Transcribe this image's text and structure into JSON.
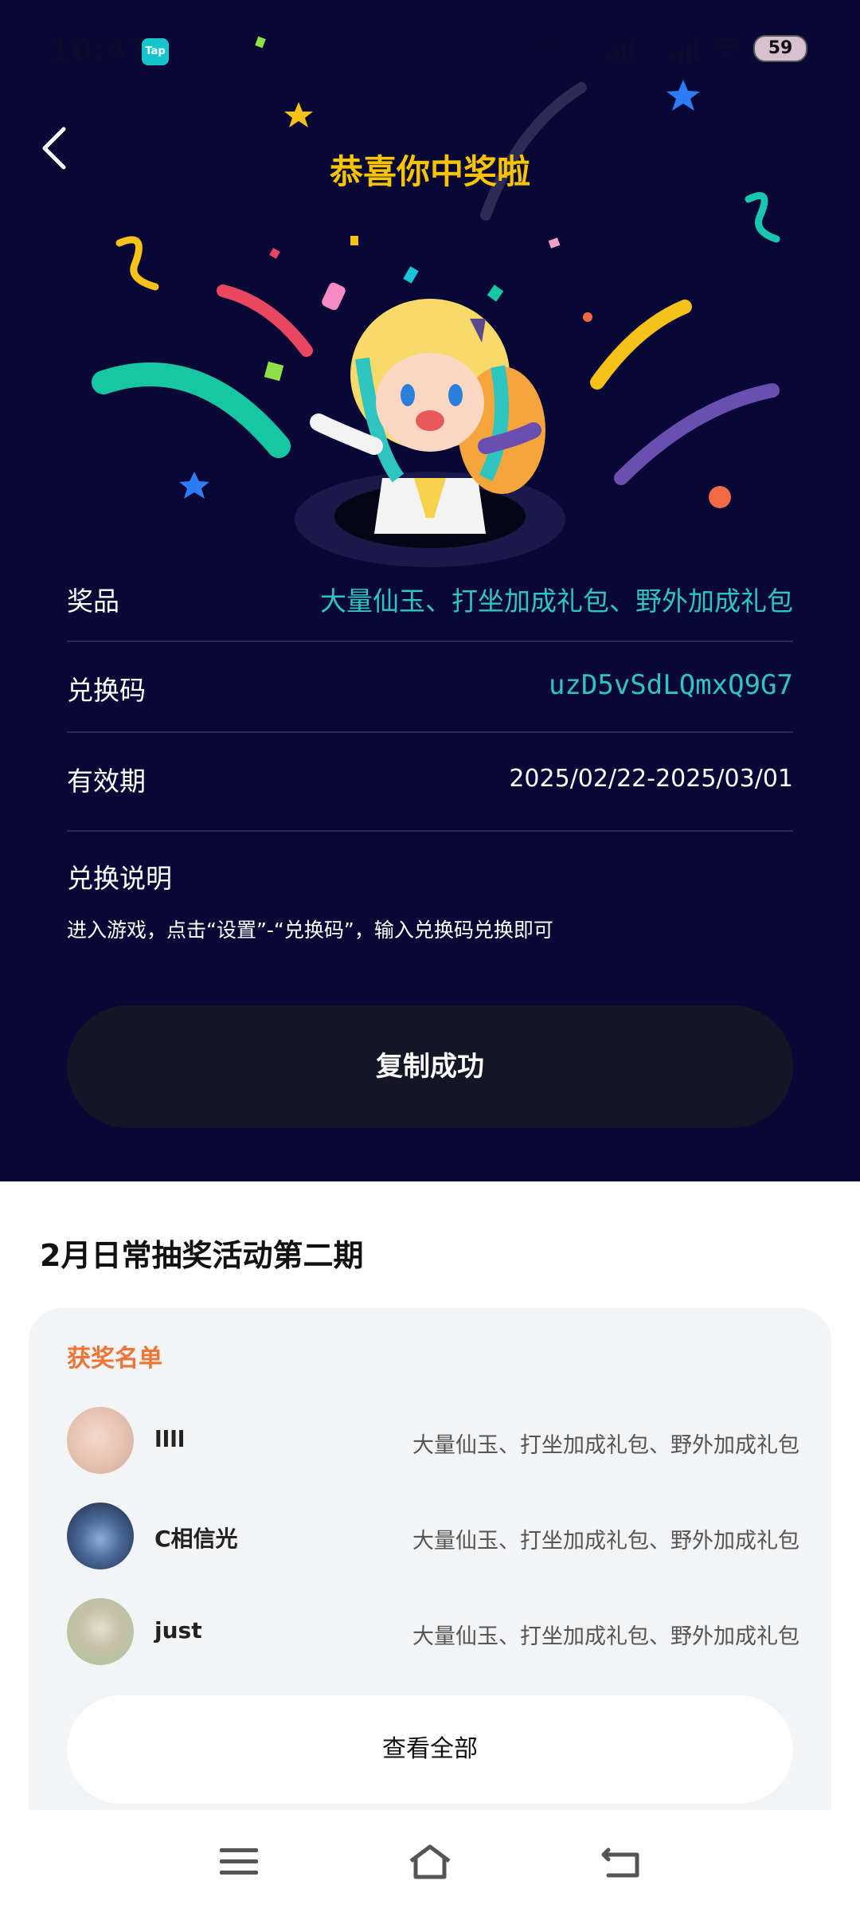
{
  "status_bar": {
    "time": "10:47",
    "app_badge": "Tap",
    "net_speed": "2.37 KB/s",
    "network_1": "5G",
    "network_2": "4G",
    "battery": "59"
  },
  "header": {
    "title": "恭喜你中奖啦"
  },
  "prize": {
    "prize_label": "奖品",
    "prize_value": "大量仙玉、打坐加成礼包、野外加成礼包",
    "code_label": "兑换码",
    "code_value": "uzD5vSdLQmxQ9G7",
    "validity_label": "有效期",
    "validity_value": "2025/02/22-2025/03/01",
    "instructions_label": "兑换说明",
    "instructions_text": "进入游戏，点击“设置”-“兑换码”，输入兑换码兑换即可",
    "copy_button": "复制成功"
  },
  "activity": {
    "title": "2月日常抽奖活动第二期",
    "winners_title": "获奖名单",
    "winners": [
      {
        "name": "llll",
        "prize": "大量仙玉、打坐加成礼包、野外加成礼包"
      },
      {
        "name": "C相信光",
        "prize": "大量仙玉、打坐加成礼包、野外加成礼包"
      },
      {
        "name": "just",
        "prize": "大量仙玉、打坐加成礼包、野外加成礼包"
      }
    ],
    "view_all": "查看全部"
  },
  "colors": {
    "background": "#080735",
    "title_yellow": "#f8c400",
    "accent_teal": "#2ec4c0",
    "orange": "#f07433"
  },
  "icons": {
    "back": "chevron-left-icon",
    "nav_menu": "menu-icon",
    "nav_home": "home-icon",
    "nav_back": "back-arrow-icon"
  }
}
